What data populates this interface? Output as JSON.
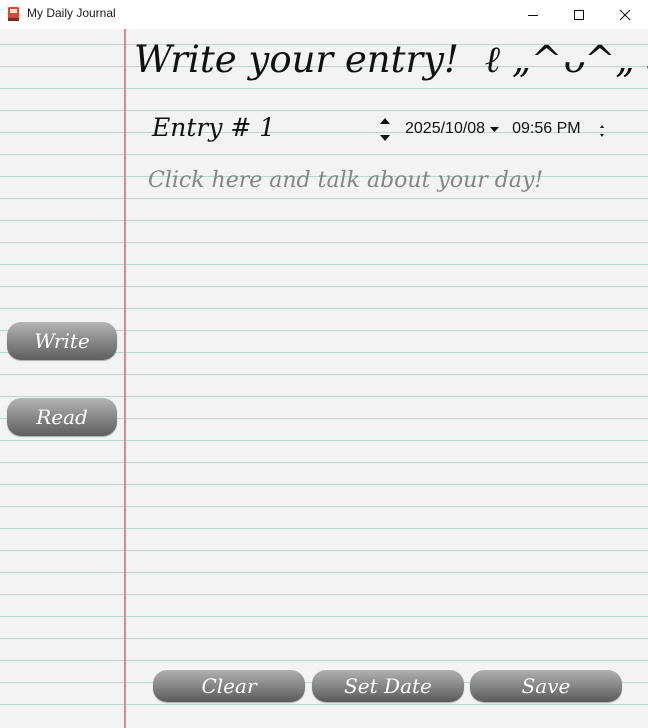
{
  "window": {
    "title": "My Daily Journal",
    "app_icon": "journal-app-icon",
    "controls": [
      "minimize-icon",
      "maximize-icon",
      "close-icon"
    ]
  },
  "sidebar": {
    "write_label": "Write",
    "read_label": "Read"
  },
  "main": {
    "heading": "Write your entry!",
    "kaomoji": "ℓ „^ᴗ^„ ↄ",
    "entry_label": "Entry # 1",
    "date": "2025/10/08",
    "time": "09:56 PM",
    "body_placeholder": "Click here and talk about your day!"
  },
  "footer": {
    "clear_label": "Clear",
    "set_date_label": "Set Date",
    "save_label": "Save"
  },
  "colors": {
    "paper": "#f3f3f3",
    "rule_line": "#b7d9d4",
    "margin_line": "#d98a8a",
    "button_dark": "#5e5e5e",
    "button_light": "#b5b5b5",
    "placeholder_text": "#858585"
  }
}
